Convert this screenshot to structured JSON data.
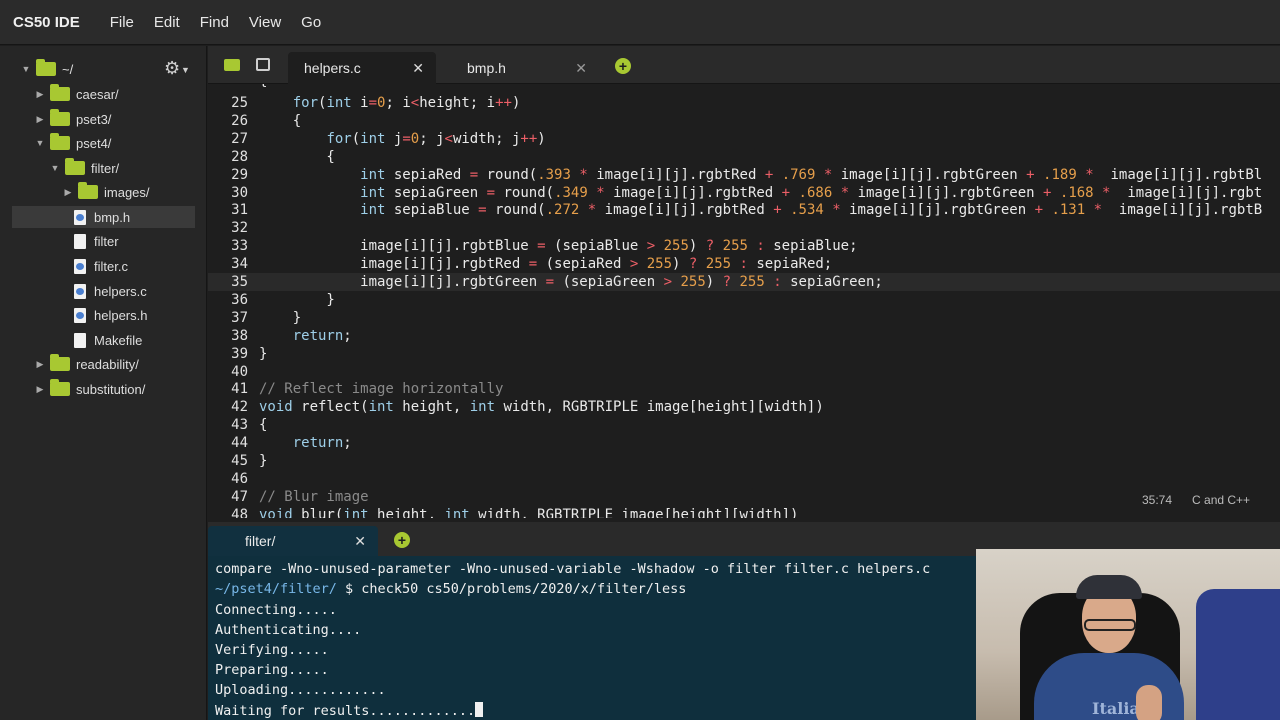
{
  "app": {
    "brand": "CS50 IDE"
  },
  "menu": [
    "File",
    "Edit",
    "Find",
    "View",
    "Go"
  ],
  "sidebar": {
    "root": "~/",
    "items": [
      {
        "label": "caesar/",
        "type": "folder",
        "expanded": false
      },
      {
        "label": "pset3/",
        "type": "folder",
        "expanded": false
      },
      {
        "label": "pset4/",
        "type": "folder",
        "expanded": true
      },
      {
        "label": "filter/",
        "type": "folder",
        "expanded": true
      },
      {
        "label": "images/",
        "type": "folder",
        "expanded": false
      },
      {
        "label": "bmp.h",
        "type": "file-h",
        "selected": true
      },
      {
        "label": "filter",
        "type": "file"
      },
      {
        "label": "filter.c",
        "type": "file-c"
      },
      {
        "label": "helpers.c",
        "type": "file-c"
      },
      {
        "label": "helpers.h",
        "type": "file-h"
      },
      {
        "label": "Makefile",
        "type": "file"
      },
      {
        "label": "readability/",
        "type": "folder",
        "expanded": false
      },
      {
        "label": "substitution/",
        "type": "folder",
        "expanded": false
      }
    ]
  },
  "editor": {
    "tabs": [
      {
        "label": "helpers.c",
        "active": true
      },
      {
        "label": "bmp.h",
        "active": false
      }
    ],
    "current_line": 35,
    "lines": [
      {
        "n": "25",
        "text": "    for(int i=0; i<height; i++)"
      },
      {
        "n": "26",
        "text": "    {"
      },
      {
        "n": "27",
        "text": "        for(int j=0; j<width; j++)"
      },
      {
        "n": "28",
        "text": "        {"
      },
      {
        "n": "29",
        "text": "            int sepiaRed = round(.393 * image[i][j].rgbtRed + .769 * image[i][j].rgbtGreen + .189 *  image[i][j].rgbtBl"
      },
      {
        "n": "30",
        "text": "            int sepiaGreen = round(.349 * image[i][j].rgbtRed + .686 * image[i][j].rgbtGreen + .168 *  image[i][j].rgbt"
      },
      {
        "n": "31",
        "text": "            int sepiaBlue = round(.272 * image[i][j].rgbtRed + .534 * image[i][j].rgbtGreen + .131 *  image[i][j].rgbtB"
      },
      {
        "n": "32",
        "text": ""
      },
      {
        "n": "33",
        "text": "            image[i][j].rgbtBlue = (sepiaBlue > 255) ? 255 : sepiaBlue;"
      },
      {
        "n": "34",
        "text": "            image[i][j].rgbtRed = (sepiaRed > 255) ? 255 : sepiaRed;"
      },
      {
        "n": "35",
        "text": "            image[i][j].rgbtGreen = (sepiaGreen > 255) ? 255 : sepiaGreen;"
      },
      {
        "n": "36",
        "text": "        }"
      },
      {
        "n": "37",
        "text": "    }"
      },
      {
        "n": "38",
        "text": "    return;"
      },
      {
        "n": "39",
        "text": "}"
      },
      {
        "n": "40",
        "text": ""
      },
      {
        "n": "41",
        "text": "// Reflect image horizontally"
      },
      {
        "n": "42",
        "text": "void reflect(int height, int width, RGBTRIPLE image[height][width])"
      },
      {
        "n": "43",
        "text": "{"
      },
      {
        "n": "44",
        "text": "    return;"
      },
      {
        "n": "45",
        "text": "}"
      },
      {
        "n": "46",
        "text": ""
      },
      {
        "n": "47",
        "text": "// Blur image"
      },
      {
        "n": "48",
        "text": "void blur(int height, int width, RGBTRIPLE image[height][width])"
      }
    ],
    "status": {
      "position": "35:74",
      "language": "C and C++"
    }
  },
  "terminal": {
    "tab_label": "filter/",
    "lines": [
      {
        "prompt": "",
        "text": "compare -Wno-unused-parameter -Wno-unused-variable -Wshadow -o filter filter.c helpers.c"
      },
      {
        "prompt": "~/pset4/filter/",
        "text": " $ check50 cs50/problems/2020/x/filter/less"
      },
      {
        "prompt": "",
        "text": "Connecting....."
      },
      {
        "prompt": "",
        "text": "Authenticating...."
      },
      {
        "prompt": "",
        "text": "Verifying....."
      },
      {
        "prompt": "",
        "text": "Preparing....."
      },
      {
        "prompt": "",
        "text": "Uploading............"
      },
      {
        "prompt": "",
        "text": "Waiting for results............."
      }
    ]
  },
  "webcam": {
    "shirt_text": "Italia"
  },
  "colors": {
    "accent_green": "#a8c832",
    "terminal_bg": "#0f2f3d",
    "keyword": "#9ecfe8",
    "number": "#e69f4b",
    "operator": "#ec5f67"
  }
}
